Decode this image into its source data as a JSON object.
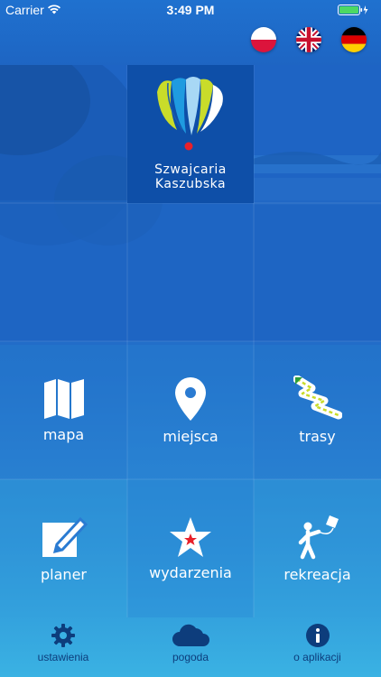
{
  "status_bar": {
    "carrier": "Carrier",
    "time": "3:49 PM"
  },
  "languages": [
    {
      "name": "polish-flag-icon"
    },
    {
      "name": "uk-flag-icon"
    },
    {
      "name": "german-flag-icon"
    }
  ],
  "logo": {
    "line1": "Szwajcaria",
    "line2": "Kaszubska"
  },
  "tiles": {
    "mapa": "mapa",
    "miejsca": "miejsca",
    "trasy": "trasy",
    "planer": "planer",
    "wydarzenia": "wydarzenia",
    "rekreacja": "rekreacja"
  },
  "tabs": {
    "ustawienia": "ustawienia",
    "pogoda": "pogoda",
    "o_aplikacji": "o aplikacji"
  },
  "colors": {
    "brand_blue": "#1e62c0",
    "tab_icon": "#0d3d7c",
    "accent_red": "#e8202a"
  }
}
